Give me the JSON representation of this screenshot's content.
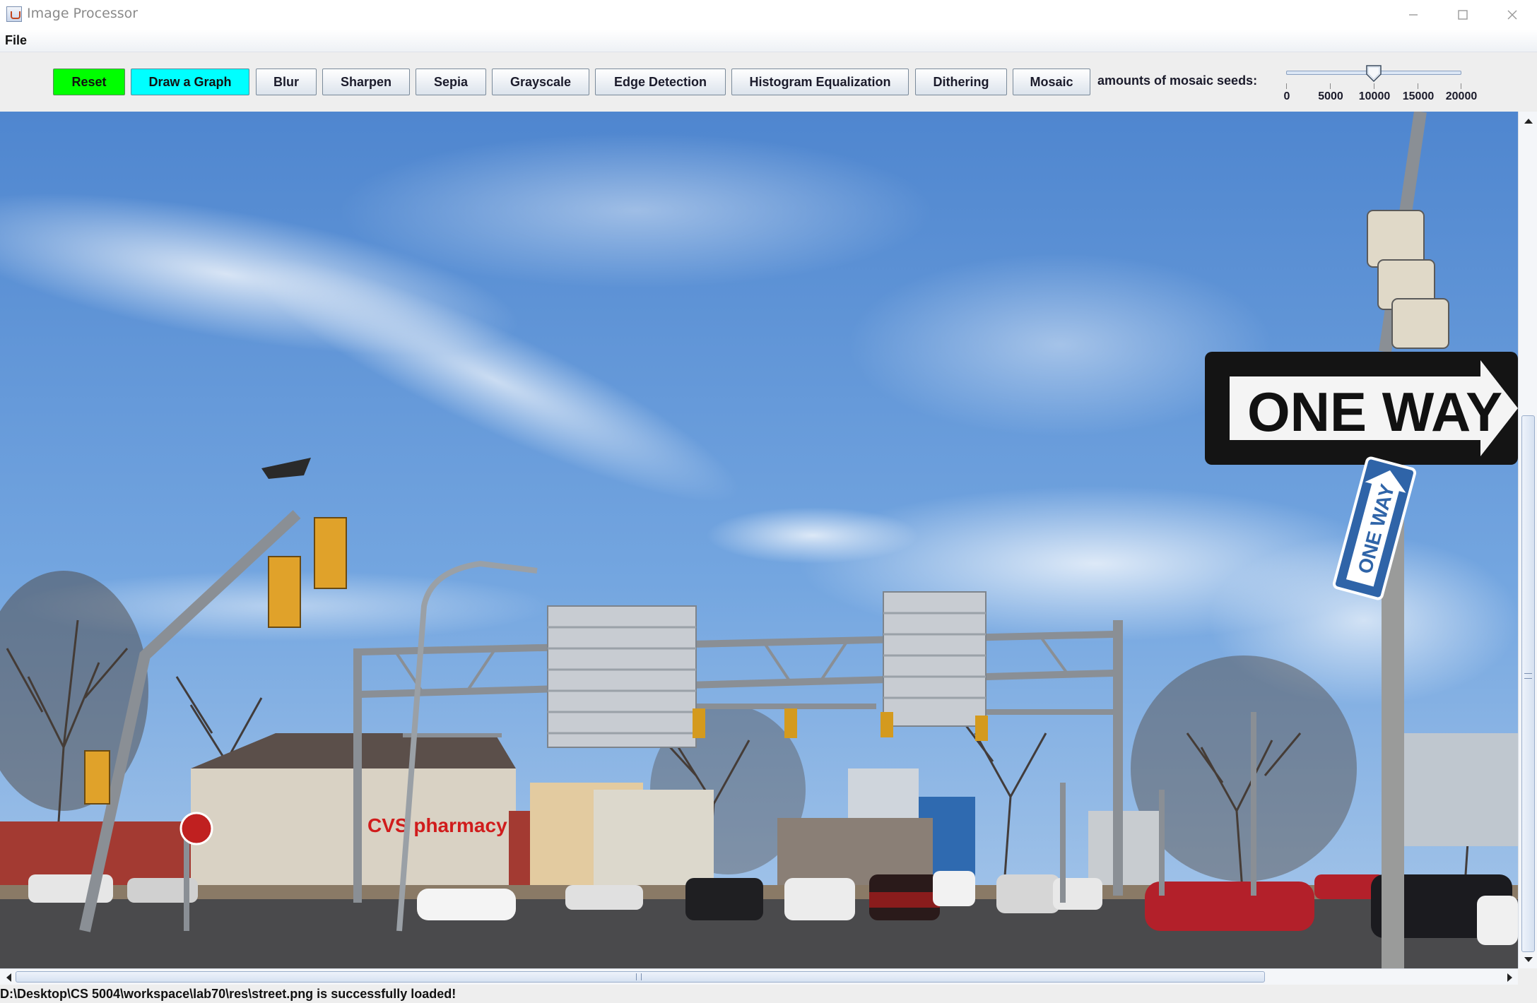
{
  "window": {
    "title": "Image Processor",
    "icon": "java-cup-icon",
    "controls": [
      "minimize-icon",
      "maximize-icon",
      "close-icon"
    ]
  },
  "menu": {
    "file_label": "File"
  },
  "toolbar": {
    "buttons": [
      {
        "id": "reset",
        "label": "Reset",
        "color": "#00ff00"
      },
      {
        "id": "draw-graph",
        "label": "Draw a Graph",
        "color": "#00ffff"
      },
      {
        "id": "blur",
        "label": "Blur"
      },
      {
        "id": "sharpen",
        "label": "Sharpen"
      },
      {
        "id": "sepia",
        "label": "Sepia"
      },
      {
        "id": "grayscale",
        "label": "Grayscale"
      },
      {
        "id": "edge-detection",
        "label": "Edge Detection"
      },
      {
        "id": "histogram-equalization",
        "label": "Histogram Equalization"
      },
      {
        "id": "dithering",
        "label": "Dithering"
      },
      {
        "id": "mosaic",
        "label": "Mosaic"
      }
    ],
    "mosaic_label": "amounts of mosaic seeds:",
    "slider": {
      "min": 0,
      "max": 20000,
      "value": 10000,
      "tick_labels": [
        "0",
        "5000",
        "10000",
        "15000",
        "20000"
      ]
    }
  },
  "image": {
    "sign_text": "ONE WAY",
    "small_sign_text": "ONE WAY",
    "store_text": "CVS pharmacy",
    "sky_color": "#5b8fd2",
    "road_color": "#4a4a4c"
  },
  "status": {
    "message": "D:\\Desktop\\CS 5004\\workspace\\lab70\\res\\street.png is successfully loaded!"
  }
}
